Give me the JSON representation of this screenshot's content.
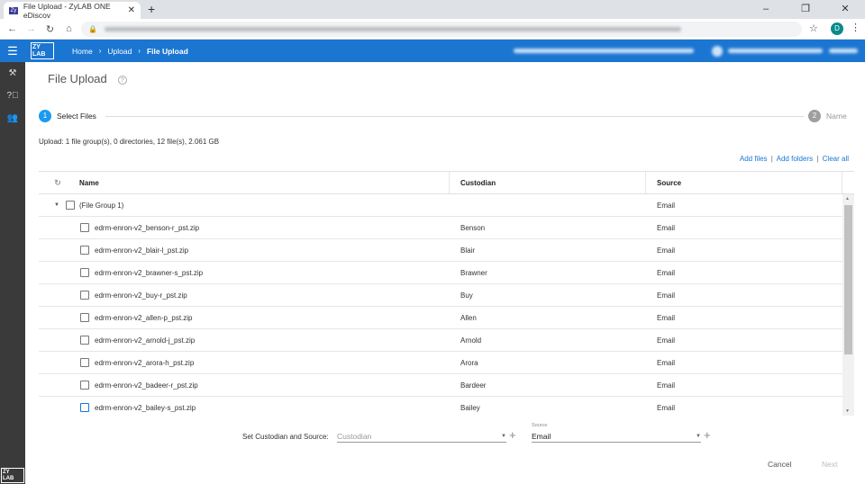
{
  "browser": {
    "tab_title": "File Upload - ZyLAB ONE eDiscov",
    "new_tab": "+",
    "profile_initial": "D"
  },
  "app": {
    "logo": "ZY ONE LAB",
    "breadcrumb": [
      "Home",
      "Upload",
      "File Upload"
    ]
  },
  "page": {
    "title": "File Upload",
    "steps": [
      {
        "number": "1",
        "label": "Select Files",
        "active": true
      },
      {
        "number": "2",
        "label": "Name",
        "active": false
      }
    ],
    "summary": "Upload: 1 file group(s), 0 directories, 12 file(s), 2.061 GB",
    "links": {
      "add_files": "Add files",
      "add_folders": "Add folders",
      "clear_all": "Clear all",
      "separator": "|"
    }
  },
  "table": {
    "headers": {
      "name": "Name",
      "custodian": "Custodian",
      "source": "Source"
    },
    "group": {
      "name": "(File Group 1)",
      "source": "Email"
    },
    "rows": [
      {
        "name": "edrm-enron-v2_benson-r_pst.zip",
        "custodian": "Benson",
        "source": "Email"
      },
      {
        "name": "edrm-enron-v2_blair-l_pst.zip",
        "custodian": "Blair",
        "source": "Email"
      },
      {
        "name": "edrm-enron-v2_brawner-s_pst.zip",
        "custodian": "Brawner",
        "source": "Email"
      },
      {
        "name": "edrm-enron-v2_buy-r_pst.zip",
        "custodian": "Buy",
        "source": "Email"
      },
      {
        "name": "edrm-enron-v2_allen-p_pst.zip",
        "custodian": "Allen",
        "source": "Email"
      },
      {
        "name": "edrm-enron-v2_arnold-j_pst.zip",
        "custodian": "Arnold",
        "source": "Email"
      },
      {
        "name": "edrm-enron-v2_arora-h_pst.zip",
        "custodian": "Arora",
        "source": "Email"
      },
      {
        "name": "edrm-enron-v2_badeer-r_pst.zip",
        "custodian": "Bardeer",
        "source": "Email"
      },
      {
        "name": "edrm-enron-v2_bailey-s_pst.zip",
        "custodian": "Bailey",
        "source": "Email"
      }
    ]
  },
  "footer": {
    "set_label": "Set Custodian and Source:",
    "custodian_placeholder": "Custodian",
    "source_label": "Source",
    "source_value": "Email",
    "cancel": "Cancel",
    "next": "Next"
  },
  "colors": {
    "primary": "#1b76d2",
    "sidebar": "#3a3a3a",
    "step_inactive": "#9e9e9e"
  }
}
